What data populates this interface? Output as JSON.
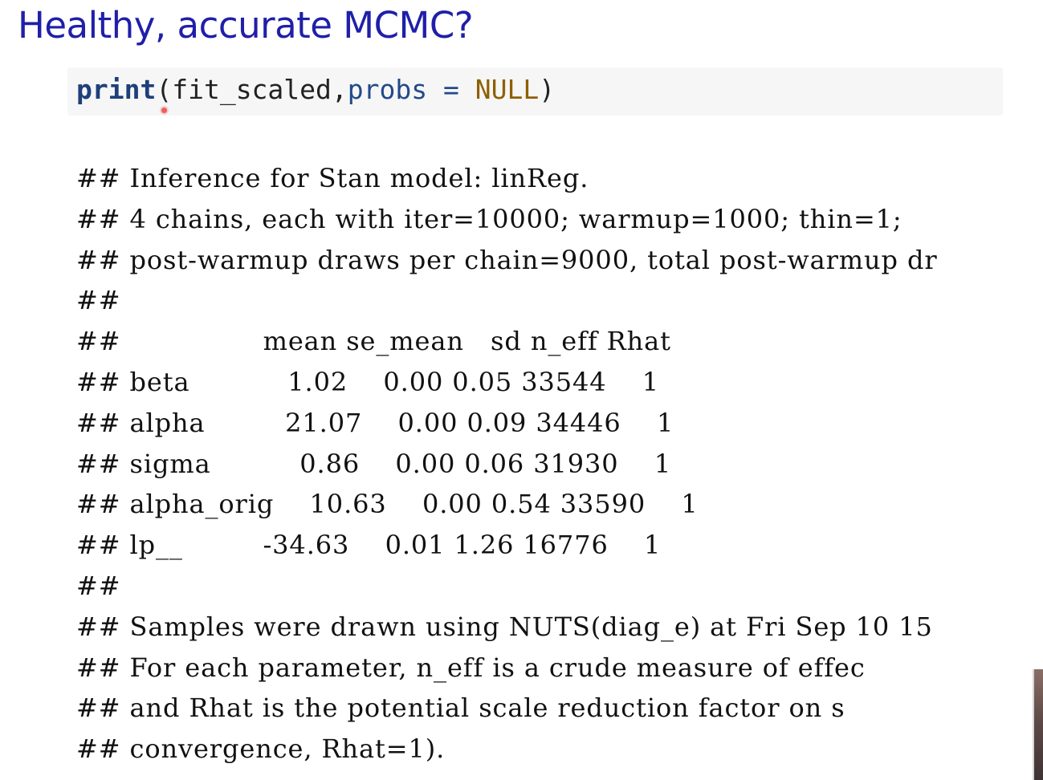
{
  "title": "Healthy, accurate MCMC?",
  "code": {
    "fn": "print",
    "open_paren": "(",
    "arg1": "fit_scaled",
    "comma": ",",
    "arg2_name": "probs",
    "equals": " = ",
    "arg2_value": "NULL",
    "close_paren": ")"
  },
  "output_lines": [
    "## Inference for Stan model: linReg.",
    "## 4 chains, each with iter=10000; warmup=1000; thin=1;",
    "## post-warmup draws per chain=9000, total post-warmup dr",
    "##",
    "##                mean se_mean   sd n_eff Rhat",
    "## beta           1.02    0.00 0.05 33544    1",
    "## alpha         21.07    0.00 0.09 34446    1",
    "## sigma          0.86    0.00 0.06 31930    1",
    "## alpha_orig    10.63    0.00 0.54 33590    1",
    "## lp__         -34.63    0.01 1.26 16776    1",
    "##",
    "## Samples were drawn using NUTS(diag_e) at Fri Sep 10 15",
    "## For each parameter, n_eff is a crude measure of effec",
    "## and Rhat is the potential scale reduction factor on s",
    "## convergence, Rhat=1)."
  ]
}
